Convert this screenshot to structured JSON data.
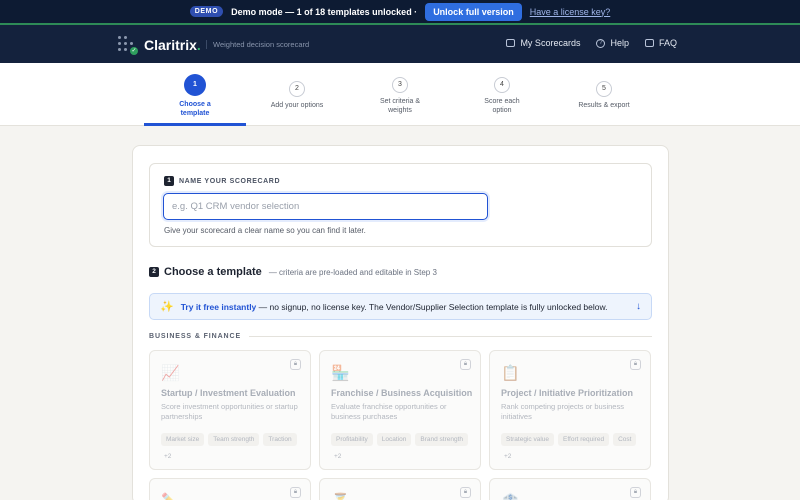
{
  "demo_bar": {
    "badge": "DEMO",
    "message": "Demo mode — 1 of 18 templates unlocked ·",
    "unlock_label": "Unlock full version",
    "license_link": "Have a license key?"
  },
  "header": {
    "brand": "Claritrix",
    "brand_dot": ".",
    "tagline": "Weighted decision scorecard",
    "nav": [
      {
        "label": "My Scorecards",
        "icon": "folder-icon"
      },
      {
        "label": "Help",
        "icon": "help-circle-icon"
      },
      {
        "label": "FAQ",
        "icon": "faq-icon"
      }
    ]
  },
  "stepper": {
    "active_step": 1,
    "steps": [
      {
        "num": "1",
        "label": "Choose a template"
      },
      {
        "num": "2",
        "label": "Add your options"
      },
      {
        "num": "3",
        "label": "Set criteria & weights"
      },
      {
        "num": "4",
        "label": "Score each option"
      },
      {
        "num": "5",
        "label": "Results & export"
      }
    ]
  },
  "name_section": {
    "num": "1",
    "label": "NAME YOUR SCORECARD",
    "placeholder": "e.g. Q1 CRM vendor selection",
    "value": "",
    "help": "Give your scorecard a clear name so you can find it later."
  },
  "template_section": {
    "num": "2",
    "title": "Choose a template",
    "subtitle": "— criteria are pre-loaded and editable in Step 3",
    "banner_strong": "Try it free instantly",
    "banner_text": " — no signup, no license key. The Vendor/Supplier Selection template is fully unlocked below.",
    "category": "BUSINESS & FINANCE",
    "cards": [
      {
        "icon": "📈",
        "name": "Startup / Investment Evaluation",
        "desc": "Score investment opportunities or startup partnerships",
        "tags": [
          "Market size",
          "Team strength",
          "Traction"
        ],
        "more": "+2"
      },
      {
        "icon": "🏪",
        "name": "Franchise / Business Acquisition",
        "desc": "Evaluate franchise opportunities or business purchases",
        "tags": [
          "Profitability",
          "Location",
          "Brand strength"
        ],
        "more": "+2"
      },
      {
        "icon": "📋",
        "name": "Project / Initiative Prioritization",
        "desc": "Rank competing projects or business initiatives",
        "tags": [
          "Strategic value",
          "Effort required",
          "Cost"
        ],
        "more": "+2"
      },
      {
        "icon": "✏️"
      },
      {
        "icon": "⏳"
      },
      {
        "icon": "🏦"
      }
    ]
  },
  "colors": {
    "accent": "#2153d4",
    "banner_bg": "#0d1b33",
    "header_bg": "#14223d",
    "brand_green": "#2fb36b"
  }
}
